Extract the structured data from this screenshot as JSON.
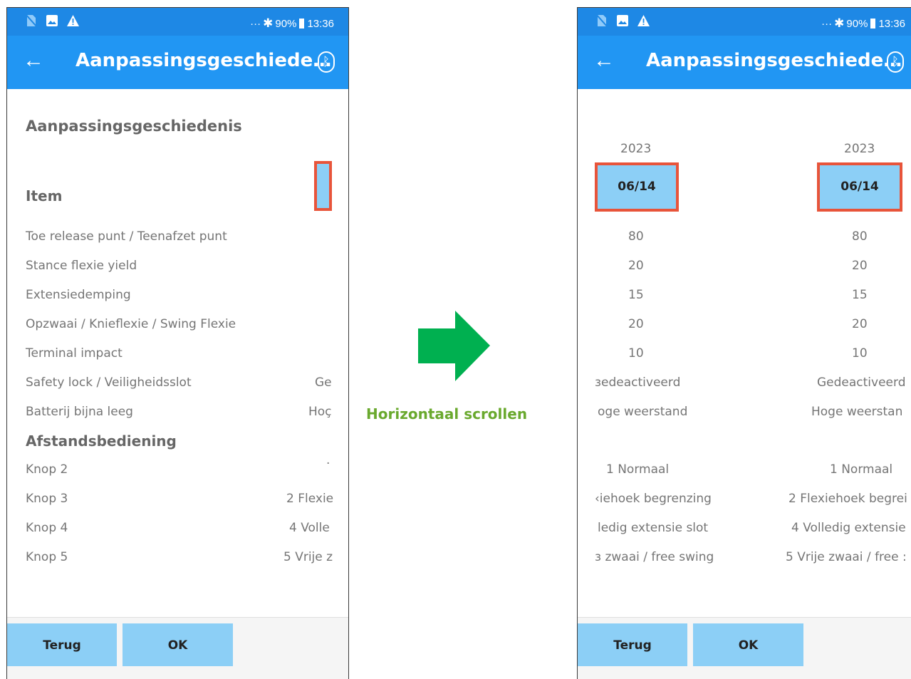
{
  "status_bar": {
    "dots": "···",
    "bluetooth_glyph": "∦",
    "battery": "90%",
    "time": "13:36"
  },
  "app_bar": {
    "back_glyph": "←",
    "title": "Aanpassingsgeschiede…",
    "bluetooth_icon": "bluetooth-icon"
  },
  "left_screen": {
    "section_title": "Aanpassingsgeschiedenis",
    "item_header": "Item",
    "rows": [
      {
        "label": "Toe release punt / Teenafzet punt",
        "value": ""
      },
      {
        "label": "Stance flexie yield",
        "value": ""
      },
      {
        "label": "Extensiedemping",
        "value": ""
      },
      {
        "label": "Opzwaai  /  Knieflexie  / Swing Flexie",
        "value": ""
      },
      {
        "label": "Terminal impact",
        "value": ""
      },
      {
        "label": "Safety lock  / Veiligheidsslot",
        "value": "Ge"
      },
      {
        "label": "Batterij bijna leeg",
        "value": "Hoç"
      }
    ],
    "remote_header": "Afstandsbediening",
    "remote_rows": [
      {
        "label": "Knop 2",
        "value": "·"
      },
      {
        "label": "Knop 3",
        "value": "2 Flexie"
      },
      {
        "label": "Knop 4",
        "value": "4 Volle"
      },
      {
        "label": "Knop 5",
        "value": "5 Vrije z"
      }
    ]
  },
  "right_screen": {
    "columns": [
      {
        "year": "2023",
        "date": "06/14",
        "values": [
          "80",
          "20",
          "15",
          "20",
          "10",
          "ɜedeactiveerd",
          "oge weerstand"
        ],
        "remote": [
          "1 Normaal",
          "‹iehoek begrenzing",
          "ledig extensie slot",
          "ɜ zwaai / free swing"
        ]
      },
      {
        "year": "2023",
        "date": "06/14",
        "values": [
          "80",
          "20",
          "15",
          "20",
          "10",
          "Gedeactiveerd",
          "Hoge weerstan"
        ],
        "remote": [
          "1 Normaal",
          "2 Flexiehoek begrei",
          "4 Volledig extensie",
          "5 Vrije zwaai / free :"
        ]
      }
    ]
  },
  "buttons": {
    "back": "Terug",
    "ok": "OK"
  },
  "caption": "Horizontaal scrollen",
  "colors": {
    "status": "#1e88e5",
    "appbar": "#2196f3",
    "highlight_fill": "#8ccff6",
    "highlight_border": "#e8543a",
    "arrow": "#00b050",
    "caption": "#6aa92e"
  }
}
